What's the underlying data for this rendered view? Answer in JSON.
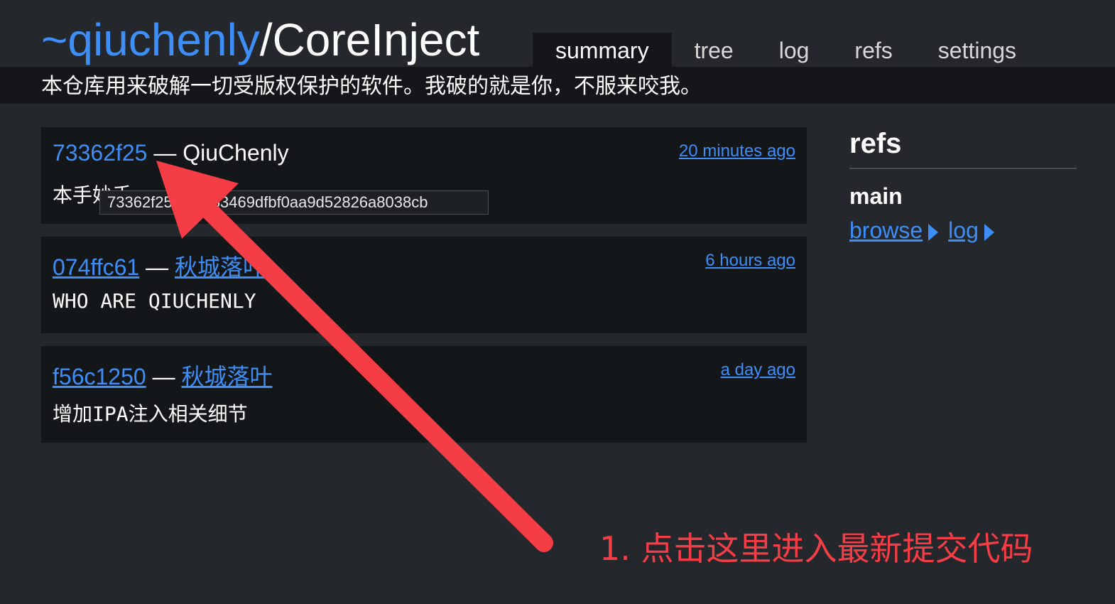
{
  "header": {
    "owner": "~qiuchenly",
    "slash": "/",
    "repo": "CoreInject",
    "tabs": [
      "summary",
      "tree",
      "log",
      "refs",
      "settings"
    ],
    "active_tab": "summary",
    "description": "本仓库用来破解一切受版权保护的软件。我破的就是你，不服来咬我。"
  },
  "commits": [
    {
      "hash": "73362f25",
      "separator": "—",
      "author": "QiuChenly",
      "time": "20 minutes ago",
      "message": "本手妙手"
    },
    {
      "hash": "074ffc61",
      "separator": "—",
      "author": "秋城落叶",
      "time": "6 hours ago",
      "message": "WHO ARE QIUCHENLY"
    },
    {
      "hash": "f56c1250",
      "separator": "—",
      "author": "秋城落叶",
      "time": "a day ago",
      "message": "增加IPA注入相关细节"
    }
  ],
  "tooltip": {
    "text": "73362f25bfd3653469dfbf0aa9d52826a8038cb"
  },
  "refs": {
    "title": "refs",
    "name": "main",
    "browse_label": "browse",
    "log_label": "log"
  },
  "annotation": {
    "text": "1. 点击这里进入最新提交代码",
    "color": "#f53d46"
  },
  "colors": {
    "background": "#24272b",
    "panel": "#14171a",
    "link": "#3d8ef7"
  }
}
